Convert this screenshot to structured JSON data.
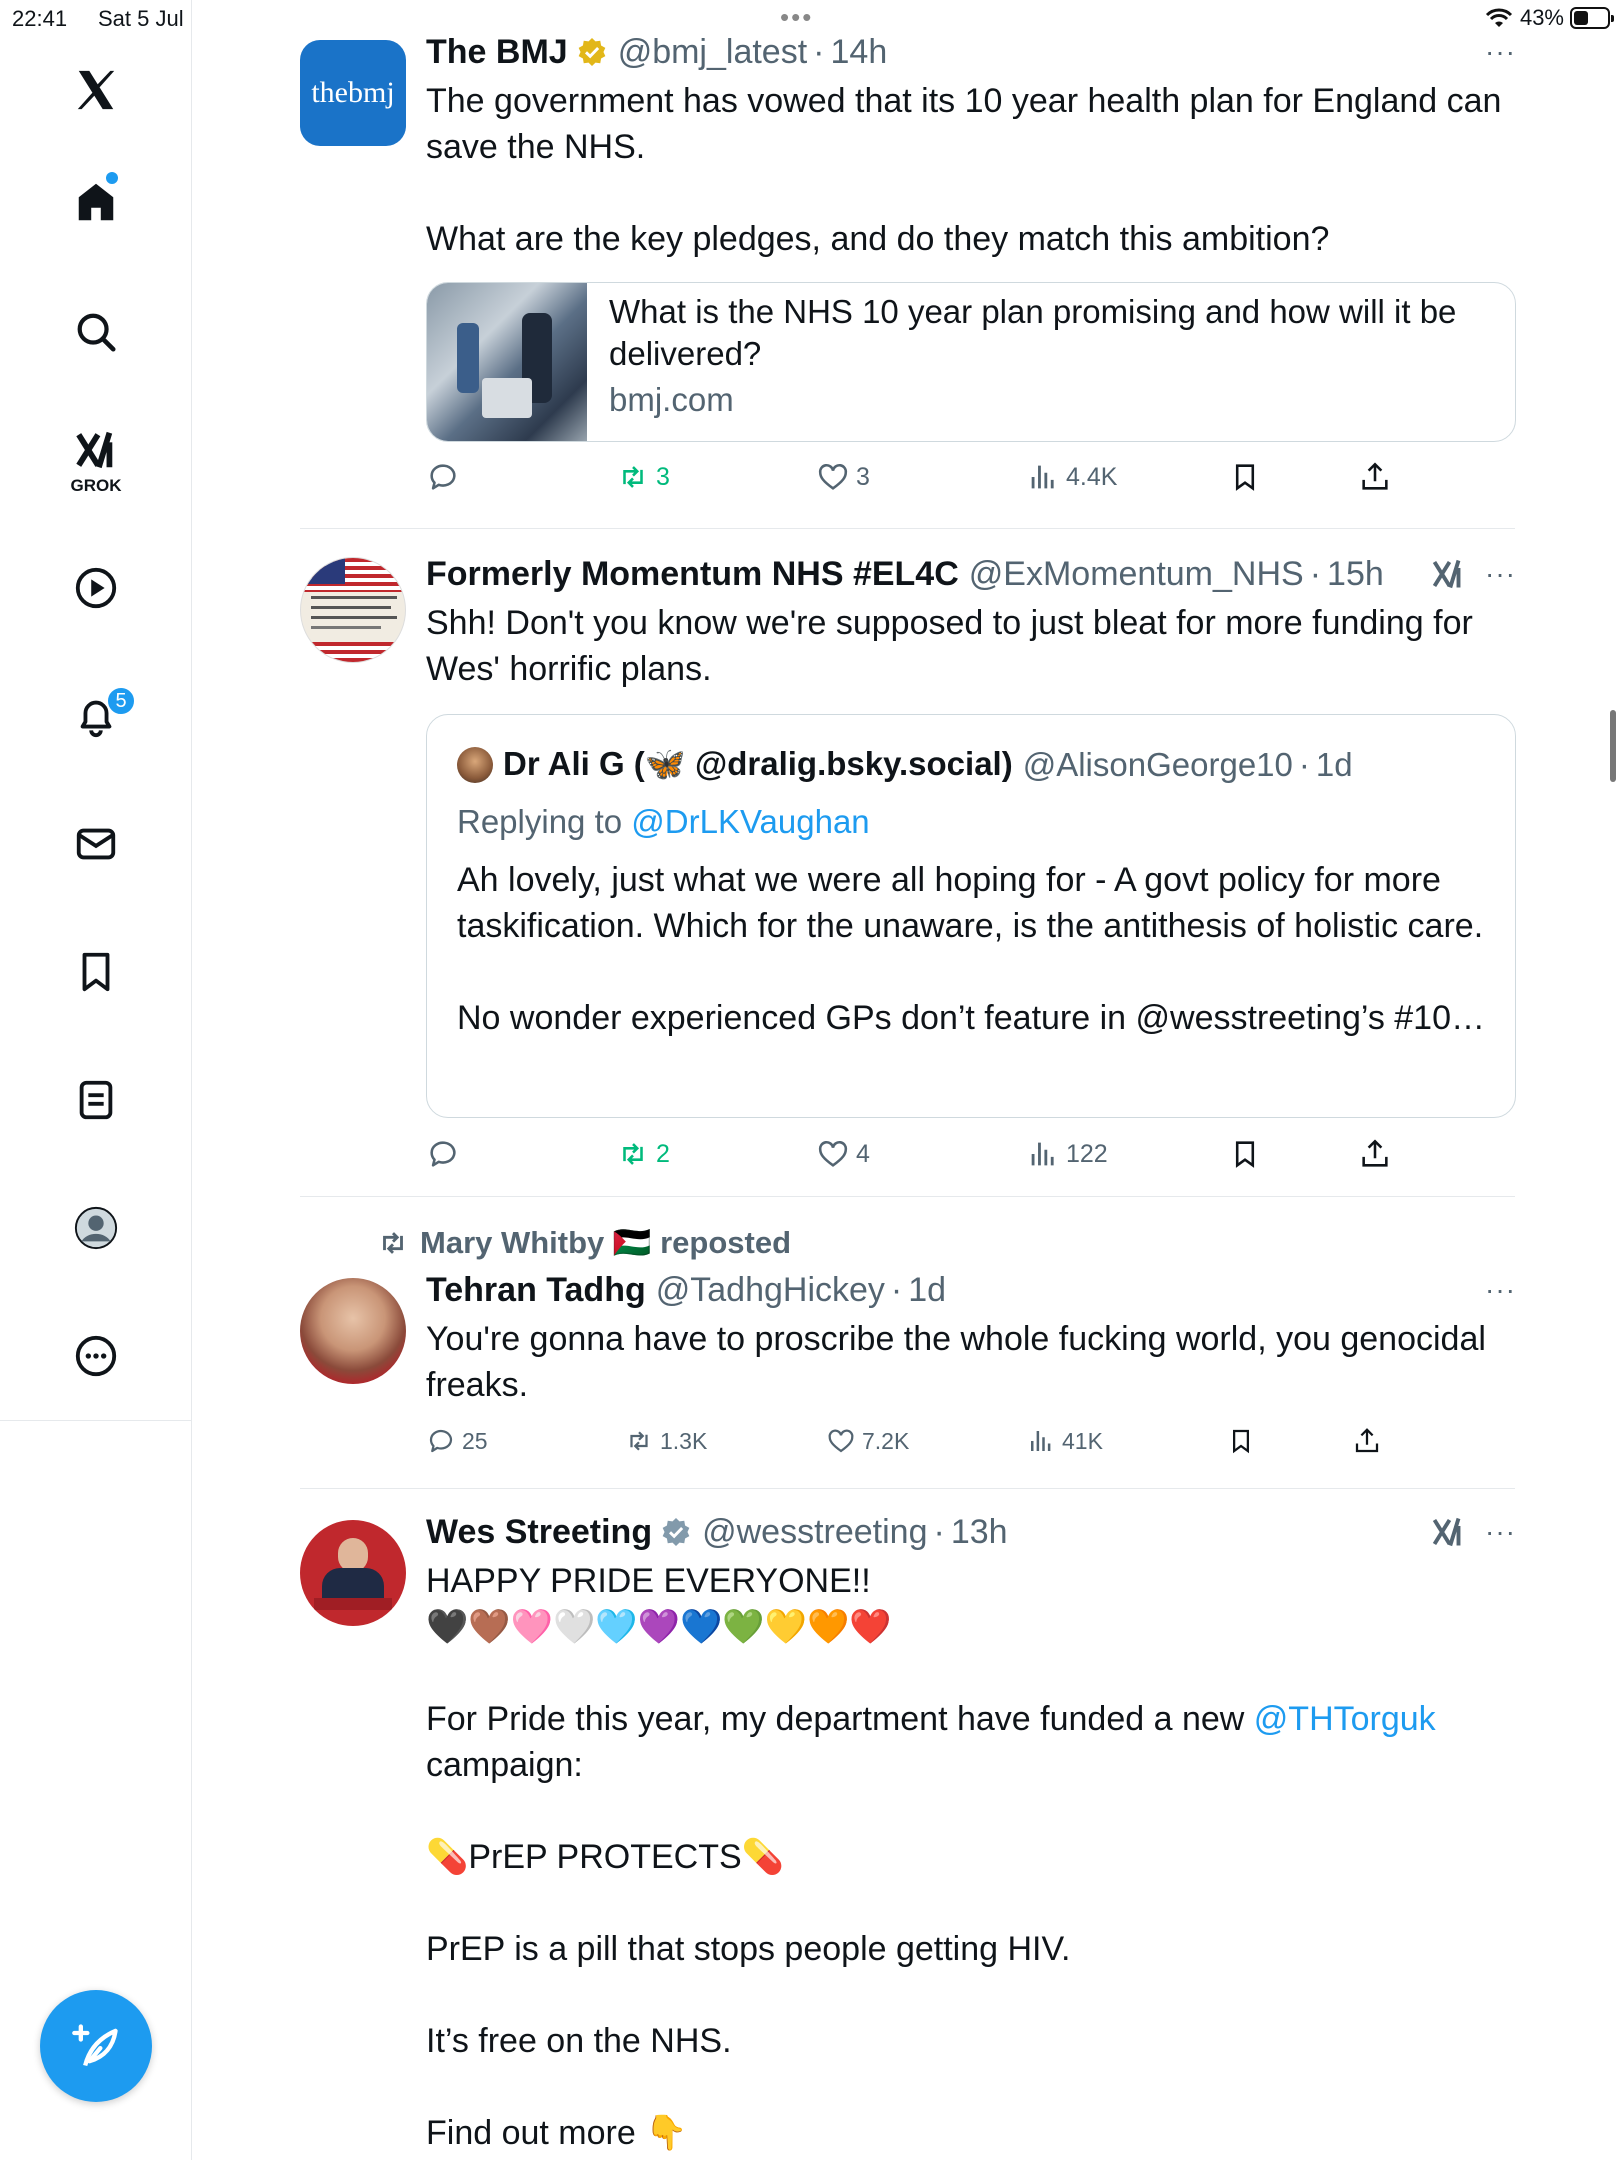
{
  "status_bar": {
    "time": "22:41",
    "date": "Sat 5 Jul",
    "battery": "43%",
    "battery_level": 0.43,
    "dots": "•••"
  },
  "sidebar": {
    "items": [
      "x-logo",
      "home",
      "explore",
      "grok",
      "video",
      "notifications",
      "messages",
      "bookmarks",
      "lists",
      "profile",
      "more"
    ],
    "grok_label": "GROK",
    "notifications_badge": "5"
  },
  "feed": {
    "posts": [
      {
        "name": "The BMJ",
        "handle": "@bmj_latest",
        "time": "14h",
        "avatar_text": "thebmj",
        "text": "The government has vowed that its 10 year health plan for England can save the NHS.\n\nWhat are the key pledges, and do they match this ambition?",
        "link_card": {
          "title": "What is the NHS 10 year plan promising and how will it be delivered?",
          "domain": "bmj.com"
        },
        "replies": "",
        "reposts": "3",
        "likes": "3",
        "views": "4.4K"
      },
      {
        "name": "Formerly Momentum NHS #EL4C",
        "handle": "@ExMomentum_NHS",
        "time": "15h",
        "text": "Shh! Don't you know we're supposed to just bleat for more funding for Wes' horrific plans.",
        "quote": {
          "name": "Dr Ali G (🦋 @dralig.bsky.social)",
          "handle": "@AlisonGeorge10",
          "time": "1d",
          "replying_prefix": "Replying to",
          "replying_to": "@DrLKVaughan",
          "text": "Ah lovely, just what we were all hoping for - A govt policy for more taskification. Which for the unaware, is the antithesis of holistic care.\n\nNo wonder experienced GPs don’t feature in @wesstreeting’s #10…"
        },
        "replies": "",
        "reposts": "2",
        "likes": "4",
        "views": "122"
      },
      {
        "repost_by": "Mary Whitby 🇵🇸 reposted",
        "name": "Tehran Tadhg",
        "handle": "@TadhgHickey",
        "time": "1d",
        "text": "You're gonna have to proscribe the whole fucking world, you genocidal freaks.",
        "replies": "25",
        "reposts": "1.3K",
        "likes": "7.2K",
        "views": "41K"
      },
      {
        "name": "Wes Streeting",
        "handle": "@wesstreeting",
        "time": "13h",
        "text_1": "HAPPY PRIDE EVERYONE!!\n🖤🤎🩷🤍🩵💜💙💚💛🧡❤️\n\nFor Pride this year, my department have funded a new ",
        "mention": "@THTorguk",
        "text_2": "\ncampaign:\n\n💊PrEP PROTECTS💊\n\nPrEP is a pill that stops people getting HIV.\n\nIt’s free on the NHS.\n\nFind out more 👇"
      }
    ]
  },
  "colors": {
    "accent": "#1d9bf0",
    "repost_green": "#00ba7c",
    "muted": "#536471",
    "verified_gold": "#e2b719"
  },
  "icons": [
    "x-logo-icon",
    "home-icon",
    "search-icon",
    "grok-icon",
    "play-icon",
    "bell-icon",
    "mail-icon",
    "bookmark-icon",
    "list-icon",
    "profile-icon",
    "more-icon",
    "compose-icon",
    "reply-icon",
    "repost-icon",
    "like-icon",
    "views-icon",
    "share-icon"
  ]
}
